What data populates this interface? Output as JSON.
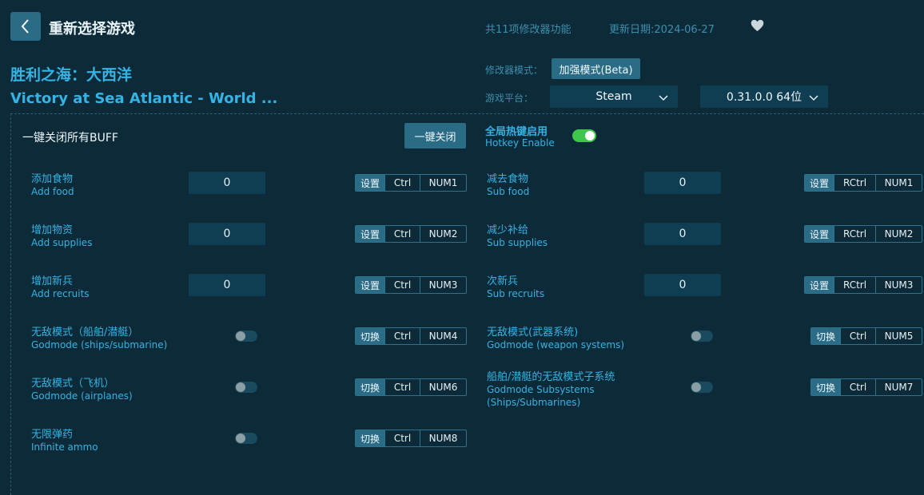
{
  "header": {
    "back_icon": "chevron-left-icon",
    "title": "重新选择游戏",
    "feature_count": "共11项修改器功能",
    "update_date": "更新日期:2024-06-27",
    "favorite_icon": "heart-icon"
  },
  "game": {
    "title_cn": "胜利之海：大西洋",
    "title_en": "Victory at Sea Atlantic - World ..."
  },
  "settings": {
    "mode_label": "修改器模式：",
    "mode_value": "加强模式(Beta)",
    "platform_label": "游戏平台：",
    "platform_value": "Steam",
    "version_value": "0.31.0.0 64位"
  },
  "panel": {
    "buff_label": "一键关闭所有BUFF",
    "close_all_button": "一键关闭",
    "hotkey_cn": "全局热键启用",
    "hotkey_en": "Hotkey Enable",
    "hotkey_enabled": true
  },
  "options": [
    {
      "cn": "添加食物",
      "en": "Add food",
      "control": "input",
      "value": "0",
      "action": "设置",
      "mod": "Ctrl",
      "key": "NUM1"
    },
    {
      "cn": "减去食物",
      "en": "Sub food",
      "control": "input",
      "value": "0",
      "action": "设置",
      "mod": "RCtrl",
      "key": "NUM1"
    },
    {
      "cn": "增加物资",
      "en": "Add supplies",
      "control": "input",
      "value": "0",
      "action": "设置",
      "mod": "Ctrl",
      "key": "NUM2"
    },
    {
      "cn": "减少补给",
      "en": "Sub supplies",
      "control": "input",
      "value": "0",
      "action": "设置",
      "mod": "RCtrl",
      "key": "NUM2"
    },
    {
      "cn": "增加新兵",
      "en": "Add recruits",
      "control": "input",
      "value": "0",
      "action": "设置",
      "mod": "Ctrl",
      "key": "NUM3"
    },
    {
      "cn": "次新兵",
      "en": "Sub recruits",
      "control": "input",
      "value": "0",
      "action": "设置",
      "mod": "RCtrl",
      "key": "NUM3"
    },
    {
      "cn": "无敌模式（船舶/潜艇）",
      "en": "Godmode (ships/submarine)",
      "control": "toggle",
      "enabled": false,
      "action": "切换",
      "mod": "Ctrl",
      "key": "NUM4"
    },
    {
      "cn": "无敌模式(武器系统)",
      "en": "Godmode (weapon systems)",
      "control": "toggle",
      "enabled": false,
      "action": "切换",
      "mod": "Ctrl",
      "key": "NUM5"
    },
    {
      "cn": "无敌模式（飞机）",
      "en": "Godmode (airplanes)",
      "control": "toggle",
      "enabled": false,
      "action": "切换",
      "mod": "Ctrl",
      "key": "NUM6"
    },
    {
      "cn": "船舶/潜艇的无敌模式子系统",
      "en": "Godmode Subsystems",
      "en2": "(Ships/Submarines)",
      "control": "toggle",
      "enabled": false,
      "action": "切换",
      "mod": "Ctrl",
      "key": "NUM7"
    },
    {
      "cn": "无限弹药",
      "en": "Infinite ammo",
      "control": "toggle",
      "enabled": false,
      "action": "切换",
      "mod": "Ctrl",
      "key": "NUM8"
    }
  ]
}
